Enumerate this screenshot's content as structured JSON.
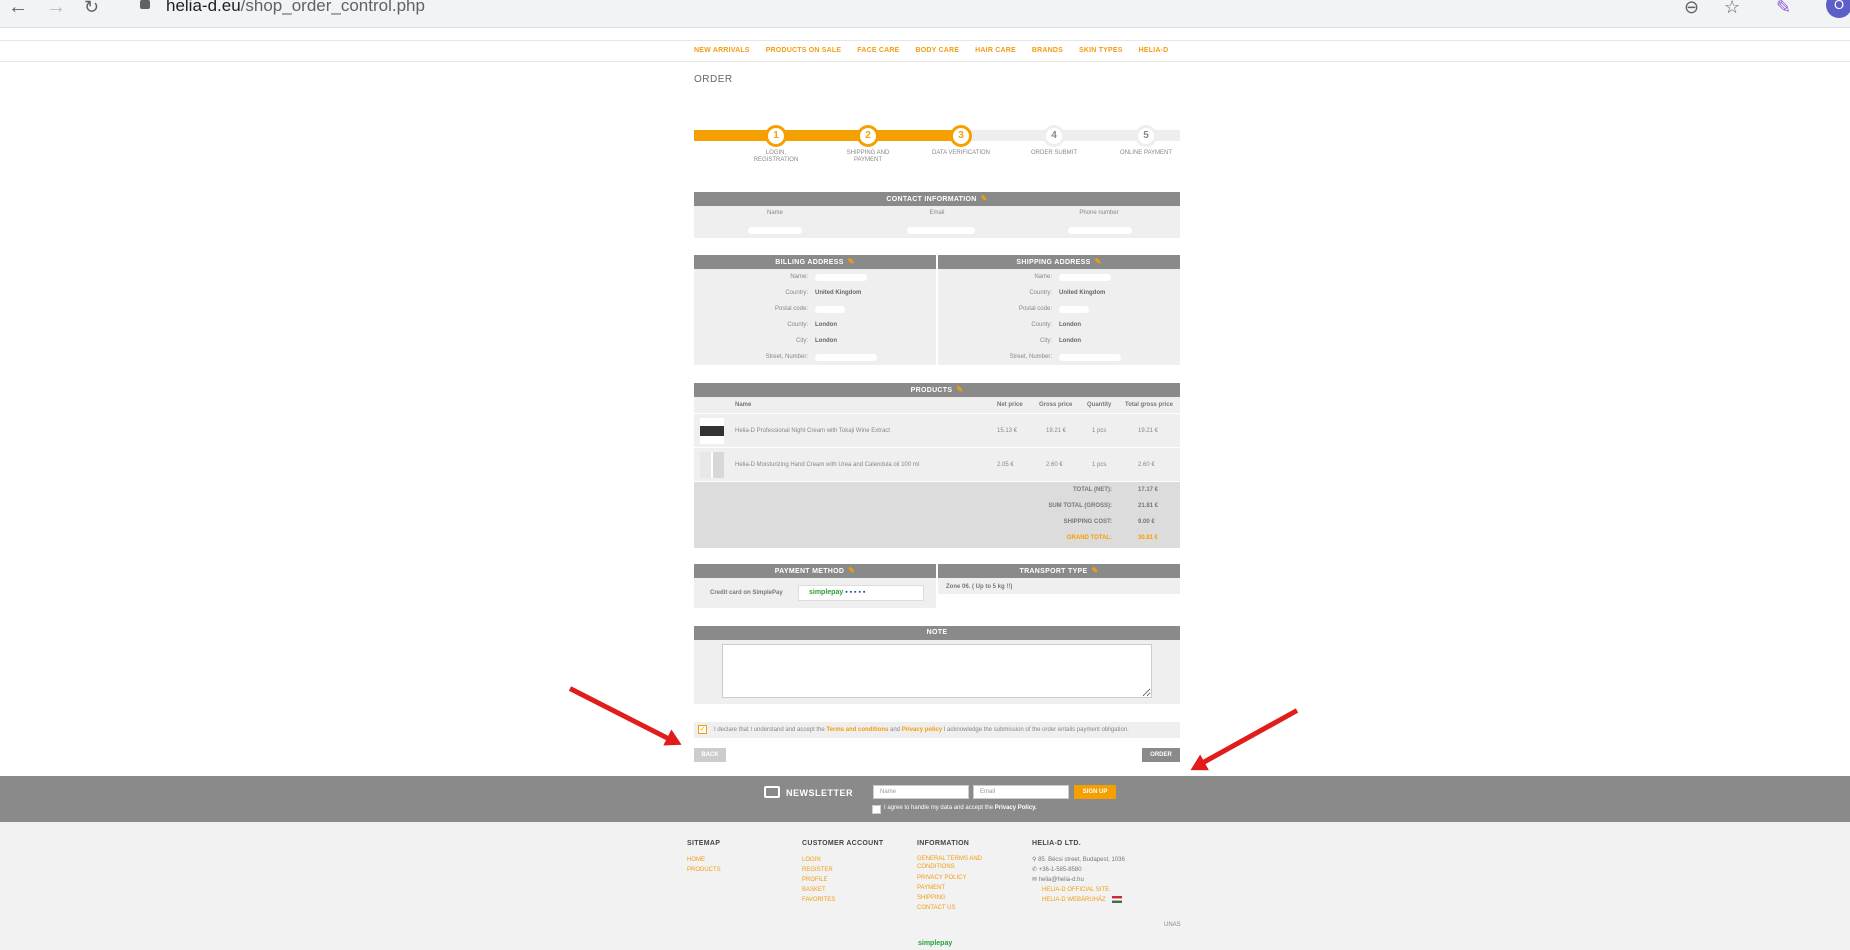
{
  "browser": {
    "url_domain": "helia-d.eu",
    "url_path": "/shop_order_control.php",
    "avatar_letter": "O"
  },
  "nav": [
    "NEW ARRIVALS",
    "PRODUCTS ON SALE",
    "FACE CARE",
    "BODY CARE",
    "HAIR CARE",
    "BRANDS",
    "SKIN TYPES",
    "HELIA-D"
  ],
  "page_title": "ORDER",
  "steps": [
    {
      "num": "1",
      "label": "LOGIN, REGISTRATION",
      "done": true
    },
    {
      "num": "2",
      "label": "SHIPPING AND PAYMENT",
      "done": true
    },
    {
      "num": "3",
      "label": "DATA VERIFICATION",
      "done": true
    },
    {
      "num": "4",
      "label": "ORDER SUBMIT",
      "done": false
    },
    {
      "num": "5",
      "label": "ONLINE PAYMENT",
      "done": false
    }
  ],
  "steps_progress": 0.55,
  "contact": {
    "title": "CONTACT INFORMATION",
    "cols": [
      "Name",
      "Email",
      "Phone number"
    ]
  },
  "billing": {
    "title": "BILLING ADDRESS",
    "rows": [
      {
        "label": "Name:",
        "value": ""
      },
      {
        "label": "Country:",
        "value": "United Kingdom"
      },
      {
        "label": "Postal code:",
        "value": ""
      },
      {
        "label": "County:",
        "value": "London"
      },
      {
        "label": "City:",
        "value": "London"
      },
      {
        "label": "Street, Number:",
        "value": ""
      }
    ]
  },
  "shipping": {
    "title": "SHIPPING ADDRESS",
    "rows": [
      {
        "label": "Name:",
        "value": ""
      },
      {
        "label": "Country:",
        "value": "United Kingdom"
      },
      {
        "label": "Postal code:",
        "value": ""
      },
      {
        "label": "County:",
        "value": "London"
      },
      {
        "label": "City:",
        "value": "London"
      },
      {
        "label": "Street, Number:",
        "value": ""
      }
    ]
  },
  "products": {
    "title": "PRODUCTS",
    "headers": [
      "Name",
      "Net price",
      "Gross price",
      "Quantity",
      "Total gross price"
    ],
    "rows": [
      {
        "name": "Helia-D Professional Night Cream with Tokaji Wine Extract",
        "net": "15.13 €",
        "gross": "19.21 €",
        "qty": "1 pcs",
        "total": "19.21 €"
      },
      {
        "name": "Helia-D Moisturizing Hand Cream with Urea and Calendula oil 100 ml",
        "net": "2.05 €",
        "gross": "2.60 €",
        "qty": "1 pcs",
        "total": "2.60 €"
      }
    ],
    "totals": [
      {
        "label": "TOTAL (NET):",
        "value": "17.17 €"
      },
      {
        "label": "SUM TOTAL (GROSS):",
        "value": "21.81 €"
      },
      {
        "label": "SHIPPING COST:",
        "value": "9.00 €"
      },
      {
        "label": "GRAND TOTAL:",
        "value": "30.81 €"
      }
    ]
  },
  "payment": {
    "title": "PAYMENT METHOD",
    "method": "Credit card on SimplePay",
    "badge": "simplepay"
  },
  "transport": {
    "title": "TRANSPORT TYPE",
    "value": "Zone 06. ( Up to 5 kg !!)"
  },
  "note": {
    "title": "NOTE"
  },
  "declare": {
    "pre": "I declare that I understand and accept the",
    "terms": "Terms and conditions",
    "and": "and",
    "privacy": "Privacy policy",
    "post": "I acknowledge the submission of the order entails payment obligation."
  },
  "buttons": {
    "back": "BACK",
    "order": "ORDER"
  },
  "newsletter": {
    "title": "NEWSLETTER",
    "name_placeholder": "Name",
    "email_placeholder": "Email",
    "signup": "SIGN UP",
    "agree_pre": "I agree to handle my data and accept the",
    "agree_link": "Privacy Policy."
  },
  "footer": {
    "sitemap": {
      "title": "SITEMAP",
      "links": [
        "HOME",
        "PRODUCTS"
      ]
    },
    "account": {
      "title": "CUSTOMER ACCOUNT",
      "links": [
        "LOGIN",
        "REGISTER",
        "PROFILE",
        "BASKET",
        "FAVORITES"
      ]
    },
    "information": {
      "title": "INFORMATION",
      "links": [
        "GENERAL TERMS AND CONDITIONS",
        "PRIVACY POLICY",
        "PAYMENT",
        "SHIPPING",
        "CONTACT US"
      ]
    },
    "company": {
      "title": "HELIA-D LTD.",
      "address": "85. Bécsi street, Budapest, 1036",
      "phone": "+36-1-585-8580",
      "email": "helia@helia-d.hu",
      "site": "HELIA-D OFFICIAL SITE",
      "webshop": "HELIA-D WEBÁRUHÁZ"
    },
    "unas": "UNAS",
    "simplepay": "simplepay"
  },
  "colors": {
    "accent": "#f5a000",
    "header_gray": "#8a8a8a",
    "arrow": "#e21b1b"
  }
}
